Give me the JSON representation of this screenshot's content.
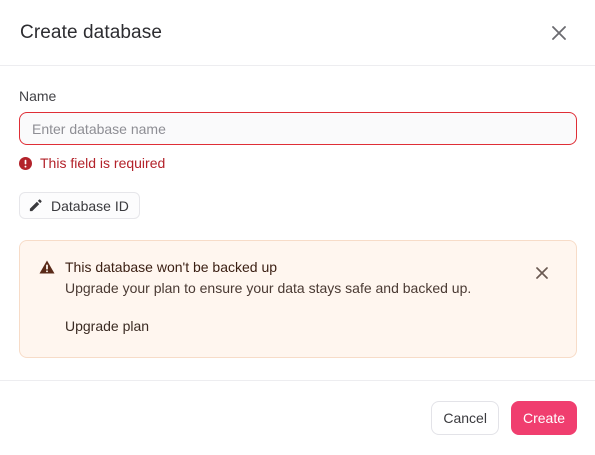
{
  "dialog": {
    "title": "Create database",
    "close_icon": "close-icon"
  },
  "form": {
    "name_label": "Name",
    "name_value": "",
    "name_placeholder": "Enter database name",
    "error_icon": "error-icon",
    "error_text": "This field is required",
    "id_icon": "pencil-icon",
    "id_label": "Database ID"
  },
  "alert": {
    "icon": "warning-icon",
    "title": "This database won't be backed up",
    "description": "Upgrade your plan to ensure your data stays safe and backed up.",
    "action_label": "Upgrade plan",
    "close_icon": "close-icon"
  },
  "footer": {
    "cancel_label": "Cancel",
    "create_label": "Create"
  },
  "colors": {
    "primary": "#f03e6f",
    "error": "#b3222a",
    "warning_bg": "#fff6ef",
    "warning_border": "#f7dcc8"
  }
}
